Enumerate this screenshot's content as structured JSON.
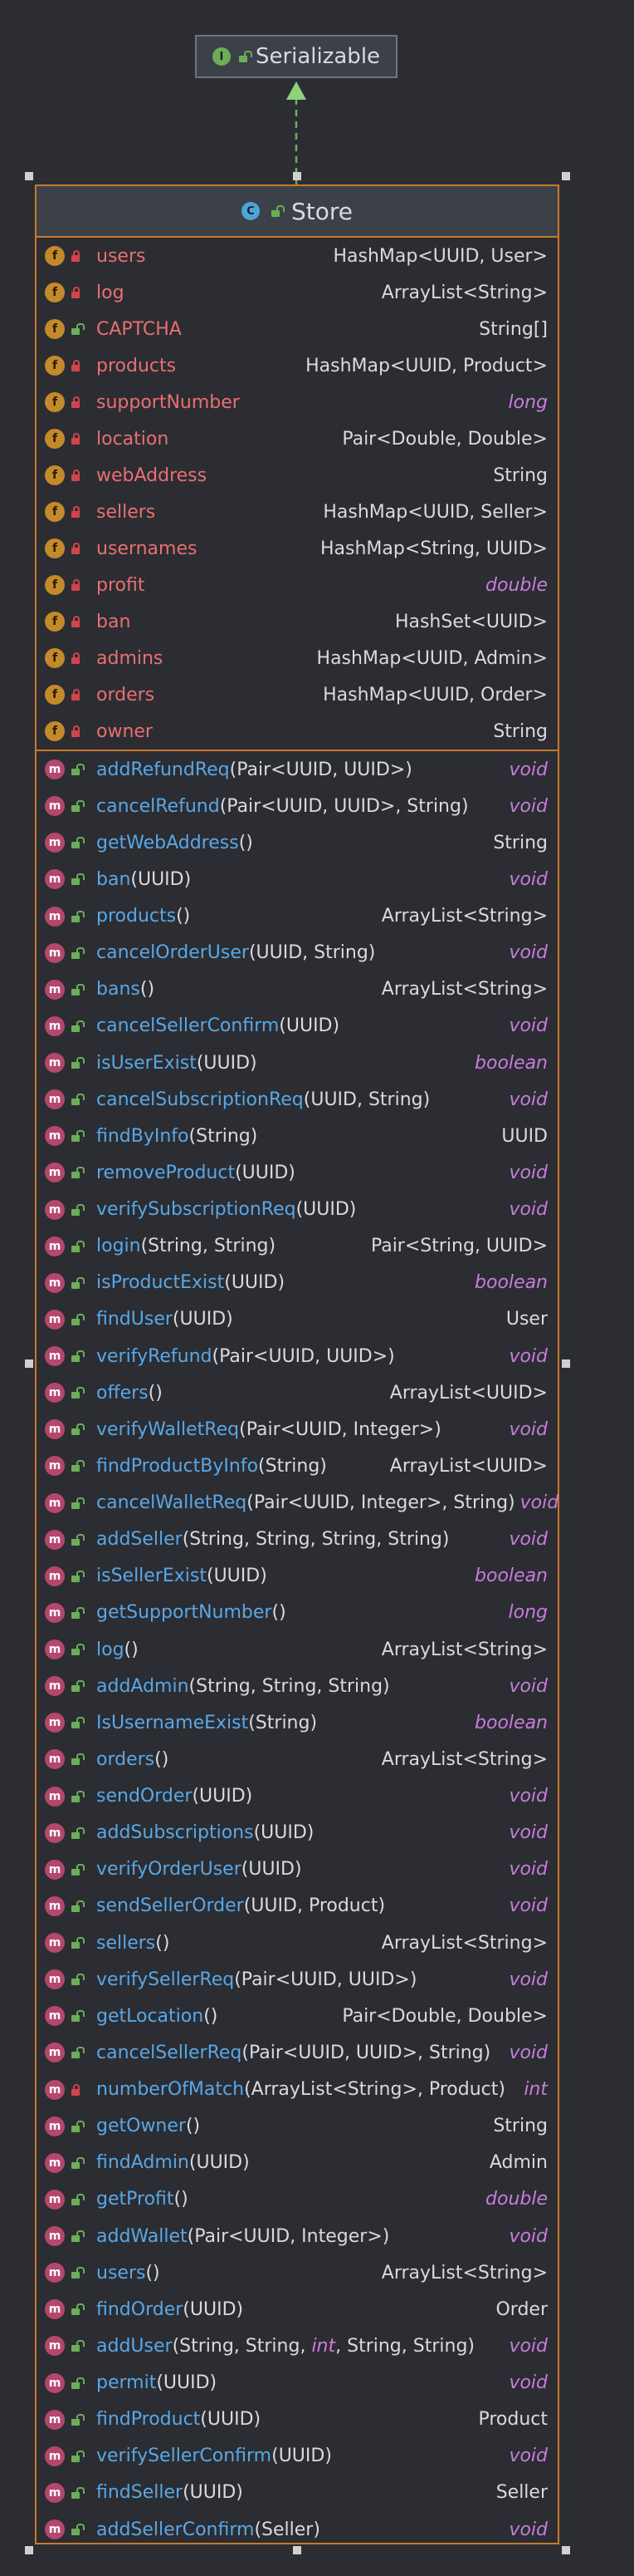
{
  "interface": {
    "name": "Serializable",
    "badge": "I"
  },
  "class": {
    "name": "Store",
    "badge": "C",
    "fields": [
      {
        "name": "users",
        "type": "HashMap<UUID, User>",
        "access": "private",
        "kw": false
      },
      {
        "name": "log",
        "type": "ArrayList<String>",
        "access": "private",
        "kw": false
      },
      {
        "name": "CAPTCHA",
        "type": "String[]",
        "access": "public",
        "kw": false
      },
      {
        "name": "products",
        "type": "HashMap<UUID, Product>",
        "access": "private",
        "kw": false
      },
      {
        "name": "supportNumber",
        "type": "long",
        "access": "private",
        "kw": true
      },
      {
        "name": "location",
        "type": "Pair<Double, Double>",
        "access": "private",
        "kw": false
      },
      {
        "name": "webAddress",
        "type": "String",
        "access": "private",
        "kw": false
      },
      {
        "name": "sellers",
        "type": "HashMap<UUID, Seller>",
        "access": "private",
        "kw": false
      },
      {
        "name": "usernames",
        "type": "HashMap<String, UUID>",
        "access": "private",
        "kw": false
      },
      {
        "name": "profit",
        "type": "double",
        "access": "private",
        "kw": true
      },
      {
        "name": "ban",
        "type": "HashSet<UUID>",
        "access": "private",
        "kw": false
      },
      {
        "name": "admins",
        "type": "HashMap<UUID, Admin>",
        "access": "private",
        "kw": false
      },
      {
        "name": "orders",
        "type": "HashMap<UUID, Order>",
        "access": "private",
        "kw": false
      },
      {
        "name": "owner",
        "type": "String",
        "access": "private",
        "kw": false
      }
    ],
    "methods": [
      {
        "name": "addRefundReq",
        "params": "(Pair<UUID, UUID>)",
        "ret": "void",
        "kw": true,
        "access": "public"
      },
      {
        "name": "cancelRefund",
        "params": "(Pair<UUID, UUID>, String)",
        "ret": "void",
        "kw": true,
        "access": "public"
      },
      {
        "name": "getWebAddress",
        "params": "()",
        "ret": "String",
        "kw": false,
        "access": "public"
      },
      {
        "name": "ban",
        "params": "(UUID)",
        "ret": "void",
        "kw": true,
        "access": "public"
      },
      {
        "name": "products",
        "params": "()",
        "ret": "ArrayList<String>",
        "kw": false,
        "access": "public"
      },
      {
        "name": "cancelOrderUser",
        "params": "(UUID, String)",
        "ret": "void",
        "kw": true,
        "access": "public"
      },
      {
        "name": "bans",
        "params": "()",
        "ret": "ArrayList<String>",
        "kw": false,
        "access": "public"
      },
      {
        "name": "cancelSellerConfirm",
        "params": "(UUID)",
        "ret": "void",
        "kw": true,
        "access": "public"
      },
      {
        "name": "isUserExist",
        "params": "(UUID)",
        "ret": "boolean",
        "kw": true,
        "access": "public"
      },
      {
        "name": "cancelSubscriptionReq",
        "params": "(UUID, String)",
        "ret": "void",
        "kw": true,
        "access": "public"
      },
      {
        "name": "findByInfo",
        "params": "(String)",
        "ret": "UUID",
        "kw": false,
        "access": "public"
      },
      {
        "name": "removeProduct",
        "params": "(UUID)",
        "ret": "void",
        "kw": true,
        "access": "public"
      },
      {
        "name": "verifySubscriptionReq",
        "params": "(UUID)",
        "ret": "void",
        "kw": true,
        "access": "public"
      },
      {
        "name": "login",
        "params": "(String, String)",
        "ret": "Pair<String, UUID>",
        "kw": false,
        "access": "public"
      },
      {
        "name": "isProductExist",
        "params": "(UUID)",
        "ret": "boolean",
        "kw": true,
        "access": "public"
      },
      {
        "name": "findUser",
        "params": "(UUID)",
        "ret": "User",
        "kw": false,
        "access": "public"
      },
      {
        "name": "verifyRefund",
        "params": "(Pair<UUID, UUID>)",
        "ret": "void",
        "kw": true,
        "access": "public"
      },
      {
        "name": "offers",
        "params": "()",
        "ret": "ArrayList<UUID>",
        "kw": false,
        "access": "public"
      },
      {
        "name": "verifyWalletReq",
        "params": "(Pair<UUID, Integer>)",
        "ret": "void",
        "kw": true,
        "access": "public"
      },
      {
        "name": "findProductByInfo",
        "params": "(String)",
        "ret": "ArrayList<UUID>",
        "kw": false,
        "access": "public"
      },
      {
        "name": "cancelWalletReq",
        "params": "(Pair<UUID, Integer>, String)",
        "ret": "void",
        "kw": true,
        "access": "public"
      },
      {
        "name": "addSeller",
        "params": "(String, String, String, String)",
        "ret": "void",
        "kw": true,
        "access": "public"
      },
      {
        "name": "isSellerExist",
        "params": "(UUID)",
        "ret": "boolean",
        "kw": true,
        "access": "public"
      },
      {
        "name": "getSupportNumber",
        "params": "()",
        "ret": "long",
        "kw": true,
        "access": "public"
      },
      {
        "name": "log",
        "params": "()",
        "ret": "ArrayList<String>",
        "kw": false,
        "access": "public"
      },
      {
        "name": "addAdmin",
        "params": "(String, String, String)",
        "ret": "void",
        "kw": true,
        "access": "public"
      },
      {
        "name": "IsUsernameExist",
        "params": "(String)",
        "ret": "boolean",
        "kw": true,
        "access": "public"
      },
      {
        "name": "orders",
        "params": "()",
        "ret": "ArrayList<String>",
        "kw": false,
        "access": "public"
      },
      {
        "name": "sendOrder",
        "params": "(UUID)",
        "ret": "void",
        "kw": true,
        "access": "public"
      },
      {
        "name": "addSubscriptions",
        "params": "(UUID)",
        "ret": "void",
        "kw": true,
        "access": "public"
      },
      {
        "name": "verifyOrderUser",
        "params": "(UUID)",
        "ret": "void",
        "kw": true,
        "access": "public"
      },
      {
        "name": "sendSellerOrder",
        "params": "(UUID, Product)",
        "ret": "void",
        "kw": true,
        "access": "public"
      },
      {
        "name": "sellers",
        "params": "()",
        "ret": "ArrayList<String>",
        "kw": false,
        "access": "public"
      },
      {
        "name": "verifySellerReq",
        "params": "(Pair<UUID, UUID>)",
        "ret": "void",
        "kw": true,
        "access": "public"
      },
      {
        "name": "getLocation",
        "params": "()",
        "ret": "Pair<Double, Double>",
        "kw": false,
        "access": "public"
      },
      {
        "name": "cancelSellerReq",
        "params": "(Pair<UUID, UUID>, String)",
        "ret": "void",
        "kw": true,
        "access": "public"
      },
      {
        "name": "numberOfMatch",
        "params": "(ArrayList<String>, Product)",
        "ret": "int",
        "kw": true,
        "access": "private"
      },
      {
        "name": "getOwner",
        "params": "()",
        "ret": "String",
        "kw": false,
        "access": "public"
      },
      {
        "name": "findAdmin",
        "params": "(UUID)",
        "ret": "Admin",
        "kw": false,
        "access": "public"
      },
      {
        "name": "getProfit",
        "params": "()",
        "ret": "double",
        "kw": true,
        "access": "public"
      },
      {
        "name": "addWallet",
        "params": "(Pair<UUID, Integer>)",
        "ret": "void",
        "kw": true,
        "access": "public"
      },
      {
        "name": "users",
        "params": "()",
        "ret": "ArrayList<String>",
        "kw": false,
        "access": "public"
      },
      {
        "name": "findOrder",
        "params": "(UUID)",
        "ret": "Order",
        "kw": false,
        "access": "public"
      },
      {
        "name": "addUser",
        "params": "(String, String, int, String, String)",
        "ret": "void",
        "kw": true,
        "access": "public",
        "intArg": true
      },
      {
        "name": "permit",
        "params": "(UUID)",
        "ret": "void",
        "kw": true,
        "access": "public"
      },
      {
        "name": "findProduct",
        "params": "(UUID)",
        "ret": "Product",
        "kw": false,
        "access": "public"
      },
      {
        "name": "verifySellerConfirm",
        "params": "(UUID)",
        "ret": "void",
        "kw": true,
        "access": "public"
      },
      {
        "name": "findSeller",
        "params": "(UUID)",
        "ret": "Seller",
        "kw": false,
        "access": "public"
      },
      {
        "name": "addSellerConfirm",
        "params": "(Seller)",
        "ret": "void",
        "kw": true,
        "access": "public"
      }
    ]
  }
}
